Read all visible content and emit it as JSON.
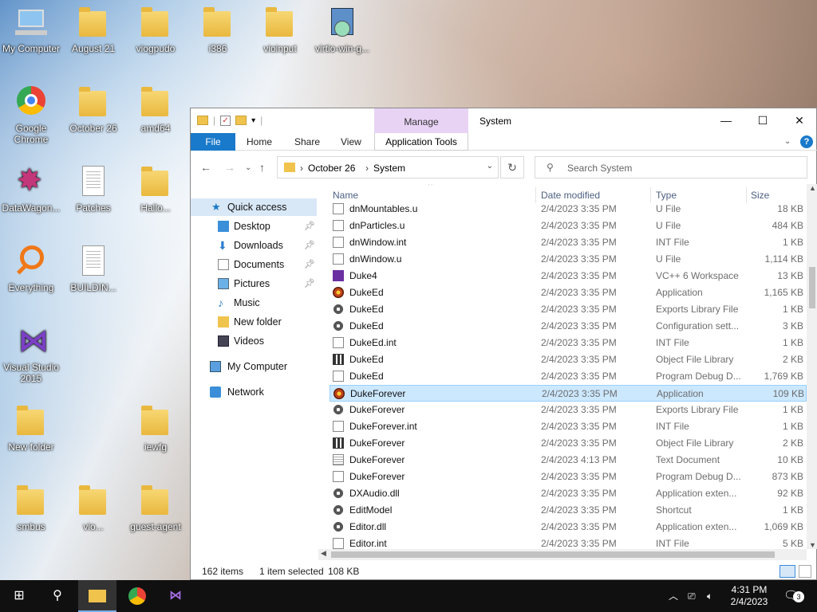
{
  "desktop": {
    "icons": [
      {
        "label": "My Computer"
      },
      {
        "label": "August 21"
      },
      {
        "label": "viogpudo"
      },
      {
        "label": "i386"
      },
      {
        "label": "vioinput"
      },
      {
        "label": "virtio-win-g..."
      },
      {
        "label": "Google Chrome"
      },
      {
        "label": "October 26"
      },
      {
        "label": "amd64"
      },
      {
        "label": "DataWagon..."
      },
      {
        "label": "Patches"
      },
      {
        "label": "Hallo..."
      },
      {
        "label": "Everything"
      },
      {
        "label": "BUILDIN..."
      },
      {
        "label": "Visual Studio 2015"
      },
      {
        "label": "New folder"
      },
      {
        "label": "iewfg"
      },
      {
        "label": "smbus"
      },
      {
        "label": "vio..."
      },
      {
        "label": "guest-agent"
      }
    ]
  },
  "window": {
    "title": "System",
    "manage_label": "Manage",
    "app_tools_label": "Application Tools",
    "tabs": [
      "File",
      "Home",
      "Share",
      "View"
    ],
    "minimize": "—",
    "maximize": "☐",
    "close": "✕",
    "address": {
      "segments": [
        "October 26",
        "System"
      ]
    },
    "search_placeholder": "Search System",
    "nav": {
      "quick_access": "Quick access",
      "items": [
        {
          "label": "Desktop",
          "pinned": true
        },
        {
          "label": "Downloads",
          "pinned": true
        },
        {
          "label": "Documents",
          "pinned": true
        },
        {
          "label": "Pictures",
          "pinned": true
        },
        {
          "label": "Music",
          "pinned": false
        },
        {
          "label": "New folder",
          "pinned": false
        },
        {
          "label": "Videos",
          "pinned": false
        }
      ],
      "my_computer": "My Computer",
      "network": "Network"
    },
    "columns": {
      "name": "Name",
      "date": "Date modified",
      "type": "Type",
      "size": "Size"
    },
    "files": [
      {
        "name": "dnMountables.u",
        "date": "2/4/2023 3:35 PM",
        "type": "U File",
        "size": "18 KB",
        "icon": "file"
      },
      {
        "name": "dnParticles.u",
        "date": "2/4/2023 3:35 PM",
        "type": "U File",
        "size": "484 KB",
        "icon": "file"
      },
      {
        "name": "dnWindow.int",
        "date": "2/4/2023 3:35 PM",
        "type": "INT File",
        "size": "1 KB",
        "icon": "file"
      },
      {
        "name": "dnWindow.u",
        "date": "2/4/2023 3:35 PM",
        "type": "U File",
        "size": "1,114 KB",
        "icon": "file"
      },
      {
        "name": "Duke4",
        "date": "2/4/2023 3:35 PM",
        "type": "VC++ 6 Workspace",
        "size": "13 KB",
        "icon": "vs"
      },
      {
        "name": "DukeEd",
        "date": "2/4/2023 3:35 PM",
        "type": "Application",
        "size": "1,165 KB",
        "icon": "app"
      },
      {
        "name": "DukeEd",
        "date": "2/4/2023 3:35 PM",
        "type": "Exports Library File",
        "size": "1 KB",
        "icon": "gear"
      },
      {
        "name": "DukeEd",
        "date": "2/4/2023 3:35 PM",
        "type": "Configuration sett...",
        "size": "3 KB",
        "icon": "gear"
      },
      {
        "name": "DukeEd.int",
        "date": "2/4/2023 3:35 PM",
        "type": "INT File",
        "size": "1 KB",
        "icon": "file"
      },
      {
        "name": "DukeEd",
        "date": "2/4/2023 3:35 PM",
        "type": "Object File Library",
        "size": "2 KB",
        "icon": "lib"
      },
      {
        "name": "DukeEd",
        "date": "2/4/2023 3:35 PM",
        "type": "Program Debug D...",
        "size": "1,769 KB",
        "icon": "pdb"
      },
      {
        "name": "DukeForever",
        "date": "2/4/2023 3:35 PM",
        "type": "Application",
        "size": "109 KB",
        "icon": "app",
        "selected": true
      },
      {
        "name": "DukeForever",
        "date": "2/4/2023 3:35 PM",
        "type": "Exports Library File",
        "size": "1 KB",
        "icon": "gear"
      },
      {
        "name": "DukeForever.int",
        "date": "2/4/2023 3:35 PM",
        "type": "INT File",
        "size": "1 KB",
        "icon": "file"
      },
      {
        "name": "DukeForever",
        "date": "2/4/2023 3:35 PM",
        "type": "Object File Library",
        "size": "2 KB",
        "icon": "lib"
      },
      {
        "name": "DukeForever",
        "date": "2/4/2023 4:13 PM",
        "type": "Text Document",
        "size": "10 KB",
        "icon": "txt"
      },
      {
        "name": "DukeForever",
        "date": "2/4/2023 3:35 PM",
        "type": "Program Debug D...",
        "size": "873 KB",
        "icon": "pdb"
      },
      {
        "name": "DXAudio.dll",
        "date": "2/4/2023 3:35 PM",
        "type": "Application exten...",
        "size": "92 KB",
        "icon": "gear"
      },
      {
        "name": "EditModel",
        "date": "2/4/2023 3:35 PM",
        "type": "Shortcut",
        "size": "1 KB",
        "icon": "gear"
      },
      {
        "name": "Editor.dll",
        "date": "2/4/2023 3:35 PM",
        "type": "Application exten...",
        "size": "1,069 KB",
        "icon": "gear"
      },
      {
        "name": "Editor.int",
        "date": "2/4/2023 3:35 PM",
        "type": "INT File",
        "size": "5 KB",
        "icon": "file"
      }
    ],
    "status": {
      "count": "162 items",
      "selection": "1 item selected",
      "size": "108 KB"
    }
  },
  "taskbar": {
    "time": "4:31 PM",
    "date": "2/4/2023",
    "notification_count": "3"
  }
}
